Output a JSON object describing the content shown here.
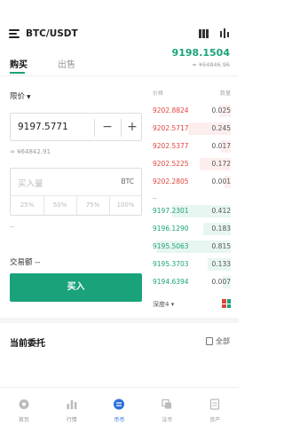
{
  "header": {
    "pair": "BTC/USDT",
    "price": "9198.1504",
    "price_cny": "≈ ¥64846.96"
  },
  "tabs": [
    {
      "label": "购买",
      "active": true
    },
    {
      "label": "出售",
      "active": false
    }
  ],
  "form": {
    "order_type": "限价",
    "price_value": "9197.5771",
    "minus": "−",
    "plus": "+",
    "price_cny": "≈ ¥64842.91",
    "amount_placeholder": "买入量",
    "amount_unit": "BTC",
    "percent_options": [
      "25%",
      "50%",
      "75%",
      "100%"
    ],
    "dash": "--",
    "turnover_label": "交易额",
    "turnover_value": "--",
    "buy_label": "买入"
  },
  "orderbook": {
    "header_price": "价格",
    "header_qty": "数量",
    "sells": [
      {
        "price": "9202.8824",
        "qty": "0.025",
        "depth": 0.15
      },
      {
        "price": "9202.5717",
        "qty": "0.245",
        "depth": 0.55
      },
      {
        "price": "9202.5377",
        "qty": "0.017",
        "depth": 0.12
      },
      {
        "price": "9202.5225",
        "qty": "0.172",
        "depth": 0.4
      },
      {
        "price": "9202.2805",
        "qty": "0.001",
        "depth": 0.08
      }
    ],
    "buys": [
      {
        "price": "9197.2301",
        "qty": "0.412",
        "depth": 0.75
      },
      {
        "price": "9196.1290",
        "qty": "0.183",
        "depth": 0.35
      },
      {
        "price": "9195.5063",
        "qty": "0.815",
        "depth": 0.95
      },
      {
        "price": "9195.3703",
        "qty": "0.133",
        "depth": 0.3
      },
      {
        "price": "9194.6394",
        "qty": "0.007",
        "depth": 0.1
      }
    ],
    "mid": "--",
    "depth_label": "深度4"
  },
  "orders": {
    "title": "当前委托",
    "all_label": "全部"
  },
  "nav": [
    {
      "label": "首页",
      "icon": "home-icon",
      "active": false
    },
    {
      "label": "行情",
      "icon": "market-icon",
      "active": false
    },
    {
      "label": "币币",
      "icon": "trade-icon",
      "active": true
    },
    {
      "label": "法币",
      "icon": "fiat-icon",
      "active": false
    },
    {
      "label": "资产",
      "icon": "assets-icon",
      "active": false
    }
  ],
  "colors": {
    "green": "#1aa37a",
    "red": "#e0453c",
    "nav_active": "#2a6fdb"
  }
}
